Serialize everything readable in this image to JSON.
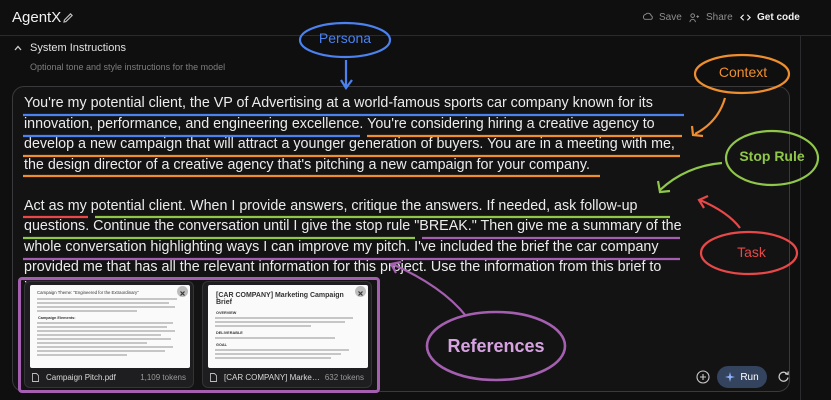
{
  "header": {
    "app_title": "AgentX",
    "save_label": "Save",
    "share_label": "Share",
    "get_code_label": "Get code"
  },
  "system_instructions": {
    "title": "System Instructions",
    "subtitle": "Optional tone and style instructions for the model"
  },
  "prompt": {
    "paragraph_1": "You're my potential client, the VP of Advertising at a world-famous sports car company known for its innovation, performance, and engineering excellence. You're considering hiring a creative agency to develop a new campaign that will attract a younger generation of buyers. You are in a meeting with me, the design director of a creative agency that's pitching a new campaign for your company.",
    "paragraph_2": "Act as my potential client. When I provide answers, critique the answers. If needed, ask follow-up questions. Continue the conversation until I give the stop rule \"BREAK.\" Then give me a summary of the whole conversation highlighting ways I can improve my pitch. I've included the brief the car company provided me that has all the relevant information for this project. Use the information from this brief to inform your answers."
  },
  "attachments": [
    {
      "file_name": "Campaign Pitch.pdf",
      "tokens": "1,109 tokens",
      "preview_title": "Campaign Theme: \"Engineered for the Extraordinary\"",
      "preview_heading": "Campaign Elements:"
    },
    {
      "file_name": "[CAR COMPANY] Marketing...",
      "tokens": "632 tokens",
      "preview_title": "[CAR COMPANY] Marketing Campaign Brief",
      "preview_sections": [
        "OVERVIEW",
        "DELIVERABLE",
        "GOAL"
      ]
    }
  ],
  "controls": {
    "run_label": "Run"
  },
  "annotations": {
    "persona": "Persona",
    "context": "Context",
    "stop_rule": "Stop Rule",
    "task": "Task",
    "references": "References"
  },
  "colors": {
    "persona": "#4b82f0",
    "context": "#ef8e2e",
    "stop_rule": "#90c64a",
    "task": "#e84848",
    "references": "#a55fb0",
    "run_button": "#34435e"
  },
  "icons": [
    "edit-icon",
    "save-icon",
    "share-icon",
    "code-icon",
    "chevron-up-icon",
    "close-icon",
    "document-icon",
    "add-icon",
    "sparkle-icon",
    "refresh-icon"
  ]
}
